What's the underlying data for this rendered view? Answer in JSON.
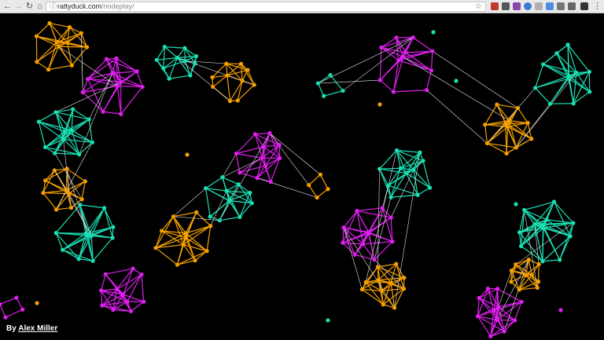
{
  "browser": {
    "url_domain": "rattyduck.com",
    "url_path": "/nodeplay/"
  },
  "credit": {
    "prefix": "By",
    "author": "Alex Miller"
  },
  "colors": {
    "background": "#000000",
    "orange": "#f5a000",
    "teal": "#19e0b4",
    "magenta": "#e01ef0",
    "connector": "#e6e6e6"
  },
  "icons": [
    "back-arrow-icon",
    "forward-arrow-icon",
    "reload-icon",
    "home-icon",
    "info-icon",
    "bookmark-star-icon",
    "extension-icons",
    "menu-icon"
  ]
}
